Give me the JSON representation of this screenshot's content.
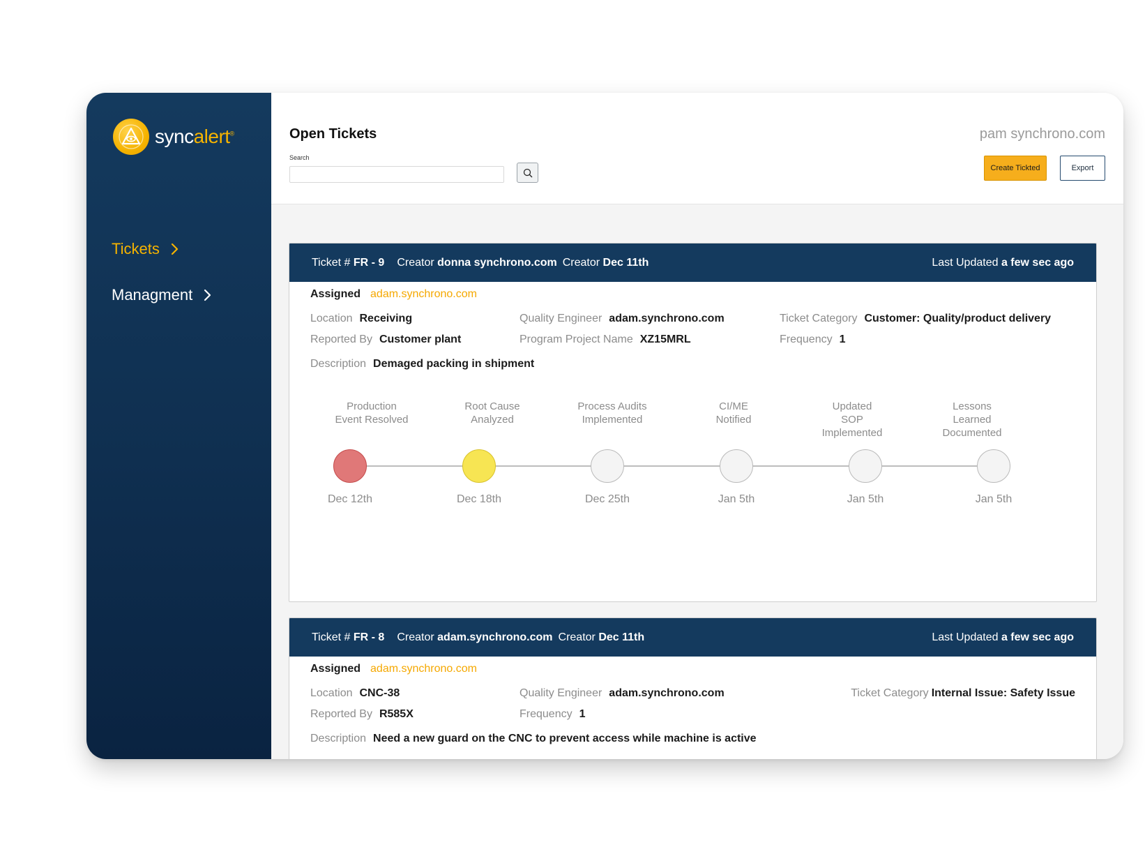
{
  "brand": {
    "name_prefix": "sync",
    "name_suffix": "alert",
    "tm": "®",
    "logo_icon": "eye-triangle-icon",
    "accent_color": "#f5b300"
  },
  "sidebar": {
    "items": [
      {
        "label": "Tickets",
        "active": true
      },
      {
        "label": "Managment",
        "active": false
      }
    ]
  },
  "header": {
    "title": "Open Tickets",
    "search_label": "Search",
    "search_value": "",
    "search_placeholder": "",
    "user": "pam synchrono.com",
    "create_label": "Create Tickted",
    "export_label": "Export"
  },
  "colors": {
    "nav_bg": "#143a5e",
    "accent": "#f6ae1c",
    "stage_done": "#e07878",
    "stage_in_progress": "#f7e553",
    "stage_pending": "#f4f4f4"
  },
  "tickets": [
    {
      "ticket_label": "Ticket #",
      "ticket_id": "FR - 9",
      "creator_label": "Creator",
      "creator": "donna synchrono.com",
      "created_label": "Creator",
      "created": "Dec 11th",
      "updated_label": "Last Updated",
      "updated": "a few sec ago",
      "assigned_label": "Assigned",
      "assigned": "adam.synchrono.com",
      "fields": {
        "location_label": "Location",
        "location": "Receiving",
        "reported_label": "Reported By",
        "reported": "Customer plant",
        "qe_label": "Quality Engineer",
        "qe": "adam.synchrono.com",
        "program_label": "Program Project Name",
        "program": "XZ15MRL",
        "category_label": "Ticket Category",
        "category": "Customer: Quality/product delivery",
        "frequency_label": "Frequency",
        "frequency": "1",
        "description_label": "Description",
        "description": "Demaged packing in shipment"
      },
      "stages": [
        {
          "line1": "Production",
          "line2": "Event Resolved",
          "line3": "",
          "date": "Dec 12th",
          "status": "done"
        },
        {
          "line1": "Root Cause",
          "line2": "Analyzed",
          "line3": "",
          "date": "Dec 18th",
          "status": "in-progress"
        },
        {
          "line1": "Process Audits",
          "line2": "Implemented",
          "line3": "",
          "date": "Dec 25th",
          "status": "pending"
        },
        {
          "line1": "CI/ME",
          "line2": "Notified",
          "line3": "",
          "date": "Jan 5th",
          "status": "pending"
        },
        {
          "line1": "Updated",
          "line2": "SOP",
          "line3": "Implemented",
          "date": "Jan 5th",
          "status": "pending"
        },
        {
          "line1": "Lessons",
          "line2": "Learned",
          "line3": "Documented",
          "date": "Jan 5th",
          "status": "pending"
        }
      ]
    },
    {
      "ticket_label": "Ticket #",
      "ticket_id": "FR - 8",
      "creator_label": "Creator",
      "creator": "adam.synchrono.com",
      "created_label": "Creator",
      "created": "Dec 11th",
      "updated_label": "Last Updated",
      "updated": "a few sec ago",
      "assigned_label": "Assigned",
      "assigned": "adam.synchrono.com",
      "fields": {
        "location_label": "Location",
        "location": "CNC-38",
        "reported_label": "Reported By",
        "reported": "R585X",
        "qe_label": "Quality Engineer",
        "qe": "adam.synchrono.com",
        "frequency_label": "Frequency",
        "frequency": "1",
        "category_label": "Ticket Category",
        "category": "Internal Issue: Safety Issue",
        "description_label": "Description",
        "description": "Need a new guard on the CNC to prevent access while machine is active"
      }
    }
  ]
}
